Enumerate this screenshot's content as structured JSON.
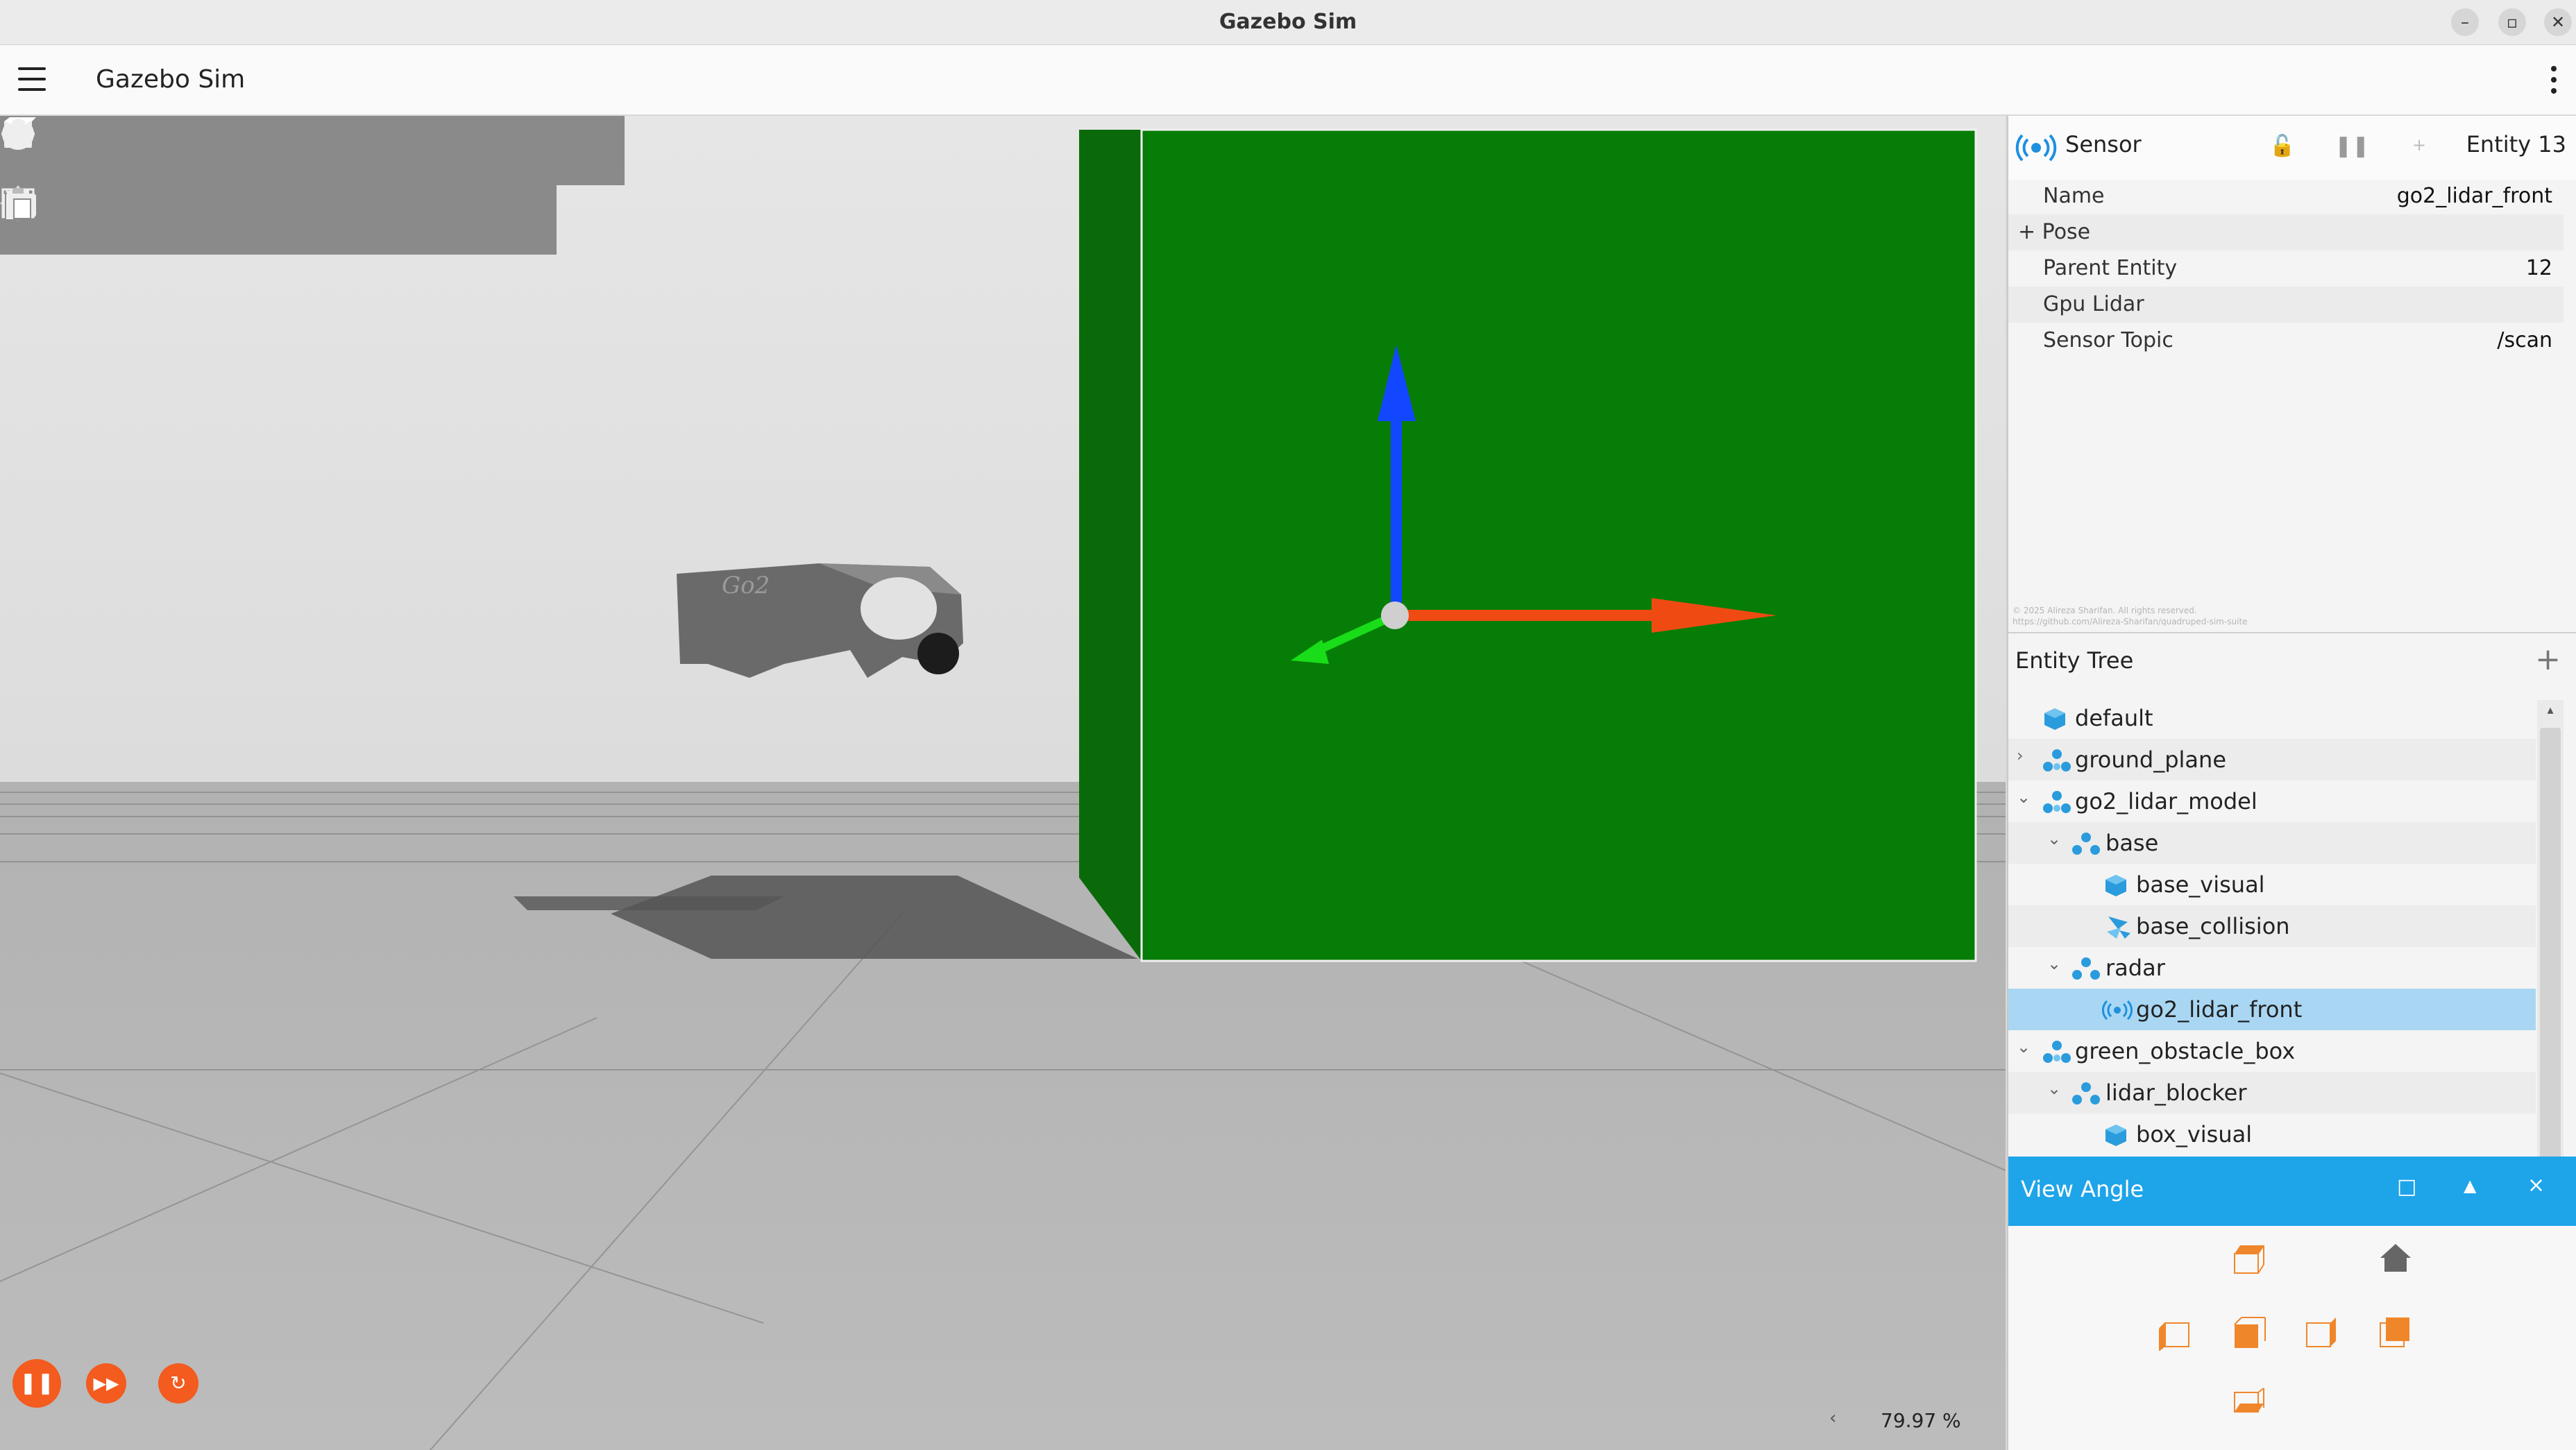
{
  "window": {
    "title": "Gazebo Sim"
  },
  "app": {
    "title": "Gazebo Sim"
  },
  "shapes_toolbar": {
    "icons": [
      "box-icon",
      "sphere-icon",
      "cone-icon",
      "cylinder-icon",
      "capsule-icon",
      "ellipsoid-icon",
      "sun-light-icon",
      "directional-light-icon",
      "spot-light-icon"
    ]
  },
  "transform_toolbar": {
    "icons": [
      "select-icon",
      "translate-icon",
      "rotate-icon",
      "scale-icon",
      "grid-snap-icon",
      "screenshot-icon",
      "copy-icon",
      "paste-icon"
    ]
  },
  "component_inspector": {
    "type": "Sensor",
    "entity": "Entity 13",
    "fields": [
      {
        "key": "Name",
        "value": "go2_lidar_front"
      },
      {
        "key": "+ Pose",
        "value": ""
      },
      {
        "key": "Parent Entity",
        "value": "12"
      },
      {
        "key": "Gpu Lidar",
        "value": ""
      },
      {
        "key": "Sensor Topic",
        "value": "/scan"
      }
    ],
    "watermark_line1": "© 2025 Alireza Sharifan. All rights reserved.",
    "watermark_line2": "https://github.com/Alireza-Sharifan/quadruped-sim-suite"
  },
  "entity_tree": {
    "title": "Entity Tree",
    "items": [
      {
        "label": "default",
        "icon": "cube-icon"
      },
      {
        "label": "ground_plane",
        "icon": "model-icon"
      },
      {
        "label": "go2_lidar_model",
        "icon": "model-icon"
      },
      {
        "label": "base",
        "icon": "link-icon"
      },
      {
        "label": "base_visual",
        "icon": "visual-icon"
      },
      {
        "label": "base_collision",
        "icon": "collision-icon"
      },
      {
        "label": "radar",
        "icon": "link-icon"
      },
      {
        "label": "go2_lidar_front",
        "icon": "sensor-icon"
      },
      {
        "label": "green_obstacle_box",
        "icon": "model-icon"
      },
      {
        "label": "lidar_blocker",
        "icon": "link-icon"
      },
      {
        "label": "box_visual",
        "icon": "visual-icon"
      }
    ]
  },
  "view_angle": {
    "title": "View Angle"
  },
  "status": {
    "rtf": "79.97 %"
  },
  "colors": {
    "accent": "#1ea4e9",
    "play": "#f35b1f",
    "green_box": "#067d06",
    "selection": "#a9d7f3"
  }
}
